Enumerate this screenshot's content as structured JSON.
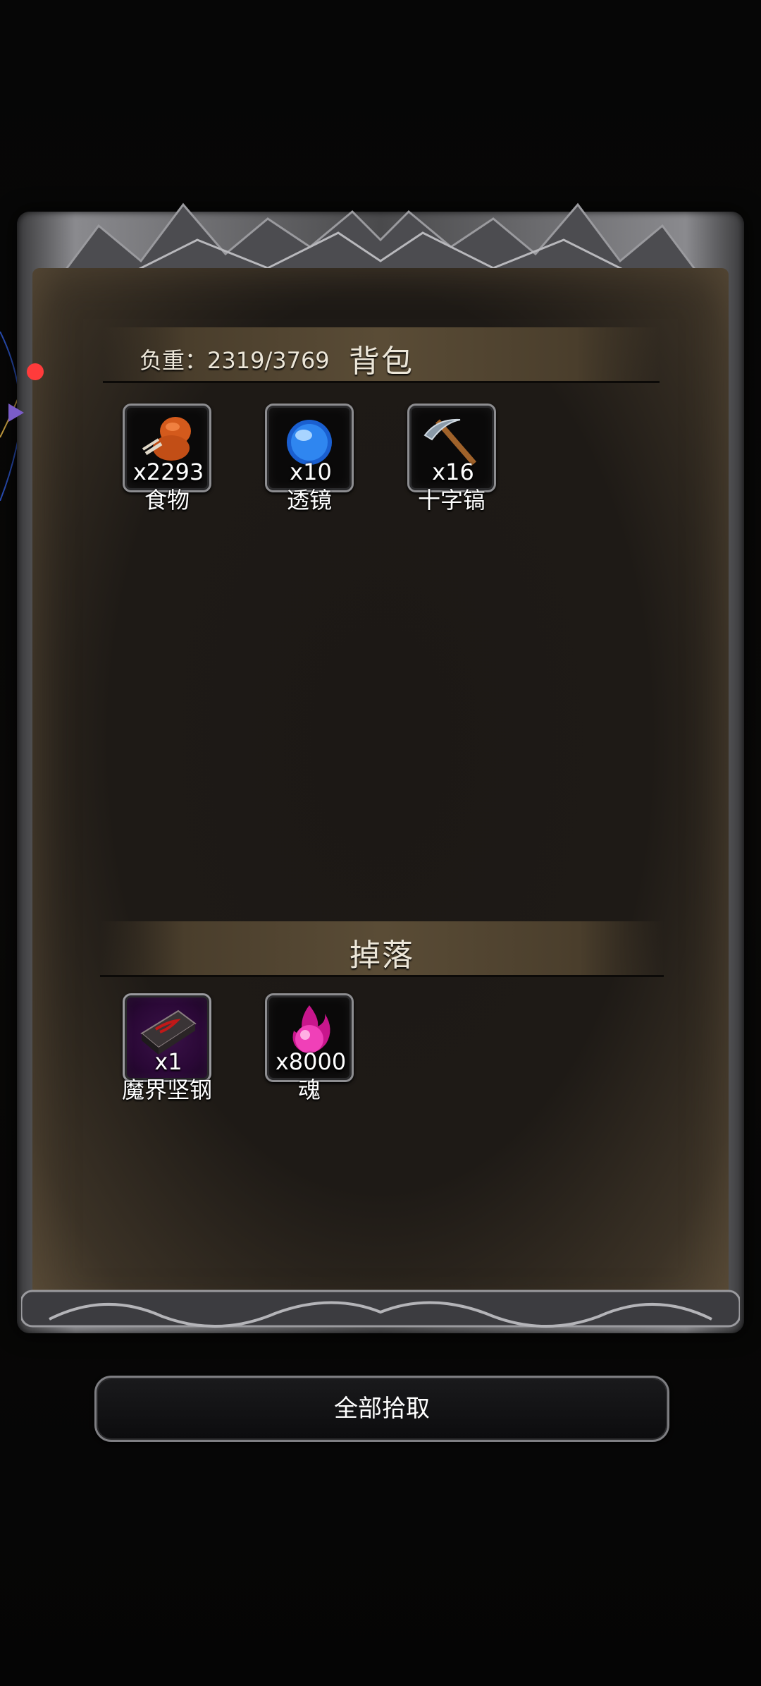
{
  "backpack": {
    "title": "背包",
    "load_label": "负重：2319/3769",
    "items": [
      {
        "name": "食物",
        "count": "x2293",
        "icon": "food-icon"
      },
      {
        "name": "透镜",
        "count": "x10",
        "icon": "lens-icon"
      },
      {
        "name": "十字镐",
        "count": "x16",
        "icon": "pickaxe-icon"
      }
    ]
  },
  "drops": {
    "title": "掉落",
    "items": [
      {
        "name": "魔界坚钢",
        "count": "x1",
        "icon": "demon-steel-icon"
      },
      {
        "name": "魂",
        "count": "x8000",
        "icon": "soul-icon"
      }
    ]
  },
  "pickup_all_label": "全部拾取",
  "colors": {
    "panel": "#1e1a16",
    "header": "#5a4c36",
    "frame": "#8a8a8e",
    "notification_dot": "#ff3b3b"
  }
}
